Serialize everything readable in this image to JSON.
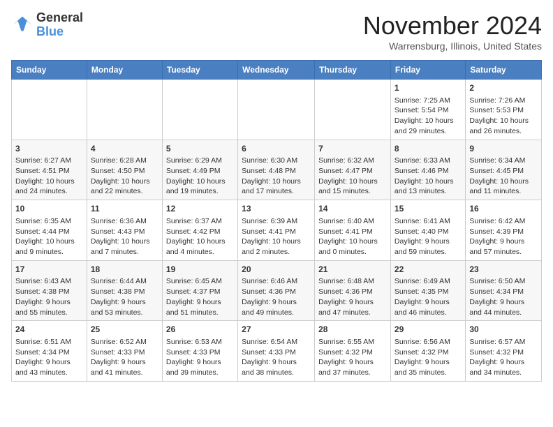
{
  "header": {
    "logo_line1": "General",
    "logo_line2": "Blue",
    "month_title": "November 2024",
    "location": "Warrensburg, Illinois, United States"
  },
  "days_of_week": [
    "Sunday",
    "Monday",
    "Tuesday",
    "Wednesday",
    "Thursday",
    "Friday",
    "Saturday"
  ],
  "weeks": [
    [
      {
        "day": "",
        "info": ""
      },
      {
        "day": "",
        "info": ""
      },
      {
        "day": "",
        "info": ""
      },
      {
        "day": "",
        "info": ""
      },
      {
        "day": "",
        "info": ""
      },
      {
        "day": "1",
        "info": "Sunrise: 7:25 AM\nSunset: 5:54 PM\nDaylight: 10 hours and 29 minutes."
      },
      {
        "day": "2",
        "info": "Sunrise: 7:26 AM\nSunset: 5:53 PM\nDaylight: 10 hours and 26 minutes."
      }
    ],
    [
      {
        "day": "3",
        "info": "Sunrise: 6:27 AM\nSunset: 4:51 PM\nDaylight: 10 hours and 24 minutes."
      },
      {
        "day": "4",
        "info": "Sunrise: 6:28 AM\nSunset: 4:50 PM\nDaylight: 10 hours and 22 minutes."
      },
      {
        "day": "5",
        "info": "Sunrise: 6:29 AM\nSunset: 4:49 PM\nDaylight: 10 hours and 19 minutes."
      },
      {
        "day": "6",
        "info": "Sunrise: 6:30 AM\nSunset: 4:48 PM\nDaylight: 10 hours and 17 minutes."
      },
      {
        "day": "7",
        "info": "Sunrise: 6:32 AM\nSunset: 4:47 PM\nDaylight: 10 hours and 15 minutes."
      },
      {
        "day": "8",
        "info": "Sunrise: 6:33 AM\nSunset: 4:46 PM\nDaylight: 10 hours and 13 minutes."
      },
      {
        "day": "9",
        "info": "Sunrise: 6:34 AM\nSunset: 4:45 PM\nDaylight: 10 hours and 11 minutes."
      }
    ],
    [
      {
        "day": "10",
        "info": "Sunrise: 6:35 AM\nSunset: 4:44 PM\nDaylight: 10 hours and 9 minutes."
      },
      {
        "day": "11",
        "info": "Sunrise: 6:36 AM\nSunset: 4:43 PM\nDaylight: 10 hours and 7 minutes."
      },
      {
        "day": "12",
        "info": "Sunrise: 6:37 AM\nSunset: 4:42 PM\nDaylight: 10 hours and 4 minutes."
      },
      {
        "day": "13",
        "info": "Sunrise: 6:39 AM\nSunset: 4:41 PM\nDaylight: 10 hours and 2 minutes."
      },
      {
        "day": "14",
        "info": "Sunrise: 6:40 AM\nSunset: 4:41 PM\nDaylight: 10 hours and 0 minutes."
      },
      {
        "day": "15",
        "info": "Sunrise: 6:41 AM\nSunset: 4:40 PM\nDaylight: 9 hours and 59 minutes."
      },
      {
        "day": "16",
        "info": "Sunrise: 6:42 AM\nSunset: 4:39 PM\nDaylight: 9 hours and 57 minutes."
      }
    ],
    [
      {
        "day": "17",
        "info": "Sunrise: 6:43 AM\nSunset: 4:38 PM\nDaylight: 9 hours and 55 minutes."
      },
      {
        "day": "18",
        "info": "Sunrise: 6:44 AM\nSunset: 4:38 PM\nDaylight: 9 hours and 53 minutes."
      },
      {
        "day": "19",
        "info": "Sunrise: 6:45 AM\nSunset: 4:37 PM\nDaylight: 9 hours and 51 minutes."
      },
      {
        "day": "20",
        "info": "Sunrise: 6:46 AM\nSunset: 4:36 PM\nDaylight: 9 hours and 49 minutes."
      },
      {
        "day": "21",
        "info": "Sunrise: 6:48 AM\nSunset: 4:36 PM\nDaylight: 9 hours and 47 minutes."
      },
      {
        "day": "22",
        "info": "Sunrise: 6:49 AM\nSunset: 4:35 PM\nDaylight: 9 hours and 46 minutes."
      },
      {
        "day": "23",
        "info": "Sunrise: 6:50 AM\nSunset: 4:34 PM\nDaylight: 9 hours and 44 minutes."
      }
    ],
    [
      {
        "day": "24",
        "info": "Sunrise: 6:51 AM\nSunset: 4:34 PM\nDaylight: 9 hours and 43 minutes."
      },
      {
        "day": "25",
        "info": "Sunrise: 6:52 AM\nSunset: 4:33 PM\nDaylight: 9 hours and 41 minutes."
      },
      {
        "day": "26",
        "info": "Sunrise: 6:53 AM\nSunset: 4:33 PM\nDaylight: 9 hours and 39 minutes."
      },
      {
        "day": "27",
        "info": "Sunrise: 6:54 AM\nSunset: 4:33 PM\nDaylight: 9 hours and 38 minutes."
      },
      {
        "day": "28",
        "info": "Sunrise: 6:55 AM\nSunset: 4:32 PM\nDaylight: 9 hours and 37 minutes."
      },
      {
        "day": "29",
        "info": "Sunrise: 6:56 AM\nSunset: 4:32 PM\nDaylight: 9 hours and 35 minutes."
      },
      {
        "day": "30",
        "info": "Sunrise: 6:57 AM\nSunset: 4:32 PM\nDaylight: 9 hours and 34 minutes."
      }
    ]
  ]
}
